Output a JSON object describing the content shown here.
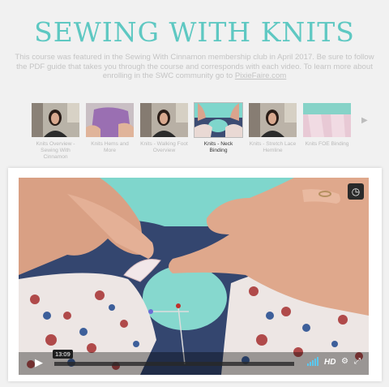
{
  "page": {
    "title": "SEWING WITH KNITS",
    "description_text": "This course was featured in the Sewing With Cinnamon membership club in April 2017. Be sure to follow the PDF guide that takes you through the course and corresponds with each video. To learn more about enrolling in the SWC community go to ",
    "description_link": "PixieFaire.com"
  },
  "thumbnails": [
    {
      "caption": "Knits Overview - Sewing With Cinnamon",
      "active": false
    },
    {
      "caption": "Knits Hems and More",
      "active": false
    },
    {
      "caption": "Knits - Walking Foot Overview",
      "active": false
    },
    {
      "caption": "Knits - Neck Binding",
      "active": true
    },
    {
      "caption": "Knits - Stretch Lace Hemline",
      "active": false
    },
    {
      "caption": "Knits FOE Binding",
      "active": false
    }
  ],
  "player": {
    "time": "13:09",
    "progress_fraction": 0.0,
    "hd_label": "HD",
    "icons": [
      "clock-icon",
      "play-icon",
      "volume-icon",
      "settings-icon",
      "airplay-icon",
      "fullscreen-icon"
    ]
  },
  "colors": {
    "title": "#5ec8c2",
    "background": "#f1f1f1",
    "accent": "#7fd6cc"
  }
}
